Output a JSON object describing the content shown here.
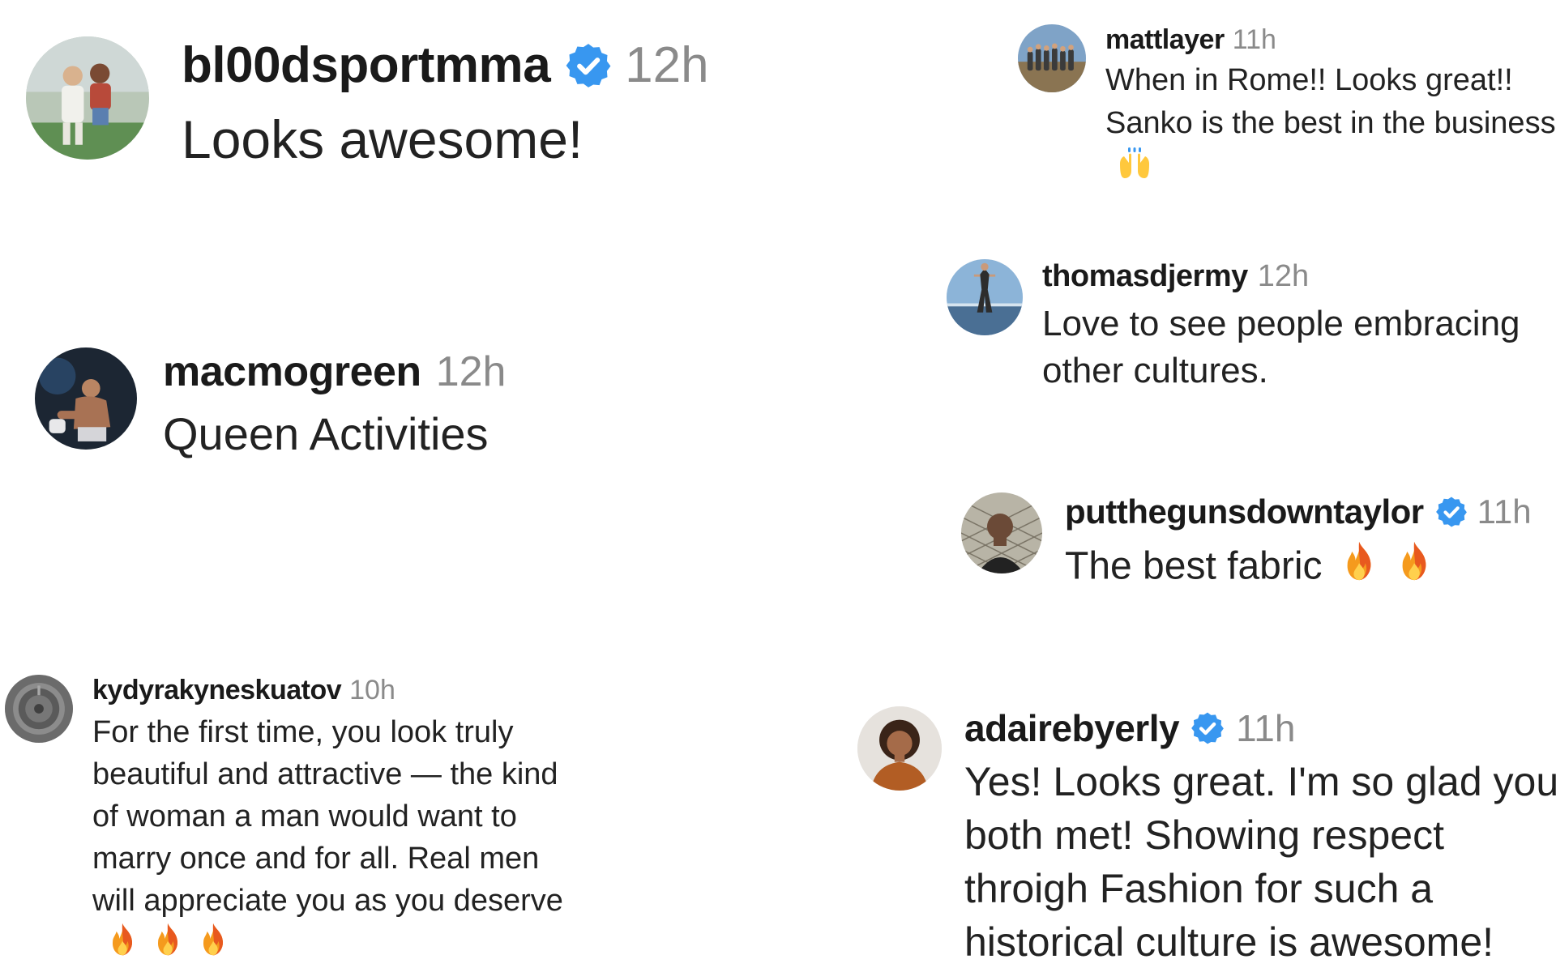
{
  "colors": {
    "verified_badge": "#3897f0",
    "timestamp": "#8a8a8a",
    "username": "#1a1a1a",
    "text": "#222222",
    "background": "#ffffff"
  },
  "comments": [
    {
      "username": "bl00dsportmma",
      "verified": true,
      "time": "12h",
      "text": "Looks awesome!",
      "avatar_icon": "user-avatar-photo"
    },
    {
      "username": "macmogreen",
      "verified": false,
      "time": "12h",
      "text": "Queen Activities",
      "avatar_icon": "user-avatar-photo"
    },
    {
      "username": "kydyrakyneskuatov",
      "verified": false,
      "time": "10h",
      "text": "For the first time, you look truly beautiful and attractive — the kind of woman a man would want to marry once and for all. Real men will appreciate you as you deserve",
      "emojis": [
        "fire-emoji",
        "fire-emoji",
        "fire-emoji"
      ],
      "avatar_icon": "user-avatar-photo"
    },
    {
      "username": "mattlayer",
      "verified": false,
      "time": "11h",
      "text": "When in Rome!! Looks great!! Sanko is the best in the business",
      "emojis": [
        "raising-hands-emoji"
      ],
      "avatar_icon": "user-avatar-photo"
    },
    {
      "username": "thomasdjermy",
      "verified": false,
      "time": "12h",
      "text": "Love to see people embracing other cultures.",
      "avatar_icon": "user-avatar-photo"
    },
    {
      "username": "putthegunsdowntaylor",
      "verified": true,
      "time": "11h",
      "text": "The best fabric",
      "emojis": [
        "fire-emoji",
        "fire-emoji"
      ],
      "avatar_icon": "user-avatar-photo"
    },
    {
      "username": "adairebyerly",
      "verified": true,
      "time": "11h",
      "text": "Yes! Looks great. I'm so glad you both met! Showing respect throigh Fashion for such a historical culture is awesome!",
      "avatar_icon": "user-avatar-photo"
    }
  ]
}
